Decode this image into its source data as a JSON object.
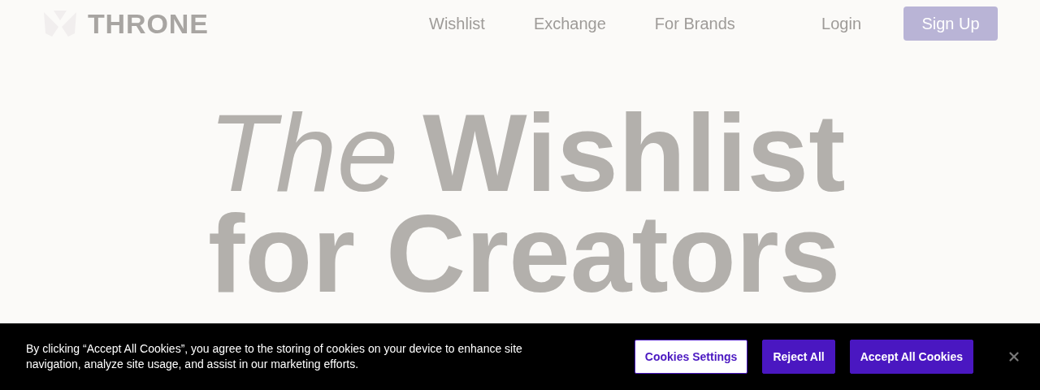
{
  "nav": {
    "logo": "THRONE",
    "links": [
      {
        "label": "Wishlist"
      },
      {
        "label": "Exchange"
      },
      {
        "label": "For Brands"
      }
    ],
    "login": "Login",
    "signup": "Sign Up"
  },
  "hero": {
    "lead": "The",
    "title_rest": "Wishlist",
    "line2": "for Creators"
  },
  "cookie_banner": {
    "text": "By clicking “Accept All Cookies”, you agree to the storing of cookies on your device to enhance site navigation, analyze site usage, and assist in our marketing efforts.",
    "buttons": [
      {
        "label": "Cookies Settings",
        "kind": "outline"
      },
      {
        "label": "Reject All",
        "kind": "solid"
      },
      {
        "label": "Accept All Cookies",
        "kind": "solid"
      }
    ]
  }
}
